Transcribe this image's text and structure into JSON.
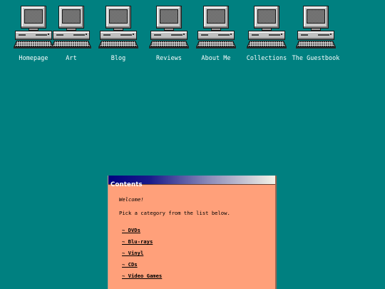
{
  "nav": {
    "items": [
      {
        "label": "Homepage",
        "icon": "computer-icon"
      },
      {
        "label": "Art",
        "icon": "computer-icon"
      },
      {
        "label": "Blog",
        "icon": "computer-icon"
      },
      {
        "label": "Reviews",
        "icon": "computer-icon"
      },
      {
        "label": "About Me",
        "icon": "computer-icon"
      },
      {
        "label": "Collections",
        "icon": "computer-icon"
      },
      {
        "label": "The Guestbook",
        "icon": "computer-icon"
      }
    ]
  },
  "window": {
    "title": "Contents",
    "welcome": "Welcome!",
    "intro": "Pick a category from the list below.",
    "categories": [
      {
        "label": "~ DVDs"
      },
      {
        "label": "~ Blu-rays"
      },
      {
        "label": "~ Vinyl"
      },
      {
        "label": "~ CDs"
      },
      {
        "label": "~ Video Games"
      }
    ]
  },
  "colors": {
    "desktop": "#008080",
    "window_body": "#ffa07a",
    "titlebar_start": "#000080",
    "titlebar_end": "#f4f4e8"
  }
}
